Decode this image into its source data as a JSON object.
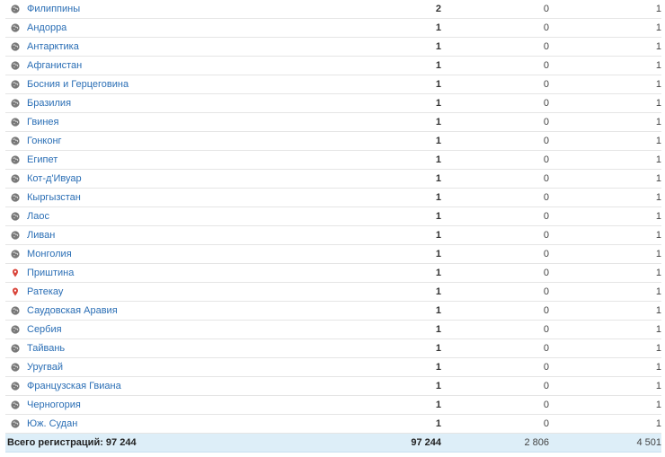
{
  "rows": [
    {
      "name": "Филиппины",
      "icon": "globe-icon",
      "a": "2",
      "b": "0",
      "c": "1"
    },
    {
      "name": "Андорра",
      "icon": "globe-icon",
      "a": "1",
      "b": "0",
      "c": "1"
    },
    {
      "name": "Антарктика",
      "icon": "globe-icon",
      "a": "1",
      "b": "0",
      "c": "1"
    },
    {
      "name": "Афганистан",
      "icon": "globe-icon",
      "a": "1",
      "b": "0",
      "c": "1"
    },
    {
      "name": "Босния и Герцеговина",
      "icon": "globe-icon",
      "a": "1",
      "b": "0",
      "c": "1"
    },
    {
      "name": "Бразилия",
      "icon": "globe-icon",
      "a": "1",
      "b": "0",
      "c": "1"
    },
    {
      "name": "Гвинея",
      "icon": "globe-icon",
      "a": "1",
      "b": "0",
      "c": "1"
    },
    {
      "name": "Гонконг",
      "icon": "globe-icon",
      "a": "1",
      "b": "0",
      "c": "1"
    },
    {
      "name": "Египет",
      "icon": "globe-icon",
      "a": "1",
      "b": "0",
      "c": "1"
    },
    {
      "name": "Кот-д'Ивуар",
      "icon": "globe-icon",
      "a": "1",
      "b": "0",
      "c": "1"
    },
    {
      "name": "Кыргызстан",
      "icon": "globe-icon",
      "a": "1",
      "b": "0",
      "c": "1"
    },
    {
      "name": "Лаос",
      "icon": "globe-icon",
      "a": "1",
      "b": "0",
      "c": "1"
    },
    {
      "name": "Ливан",
      "icon": "globe-icon",
      "a": "1",
      "b": "0",
      "c": "1"
    },
    {
      "name": "Монголия",
      "icon": "globe-icon",
      "a": "1",
      "b": "0",
      "c": "1"
    },
    {
      "name": "Приштина",
      "icon": "map-pin-icon",
      "a": "1",
      "b": "0",
      "c": "1"
    },
    {
      "name": "Ратекау",
      "icon": "map-pin-icon",
      "a": "1",
      "b": "0",
      "c": "1"
    },
    {
      "name": "Саудовская Аравия",
      "icon": "globe-icon",
      "a": "1",
      "b": "0",
      "c": "1"
    },
    {
      "name": "Сербия",
      "icon": "globe-icon",
      "a": "1",
      "b": "0",
      "c": "1"
    },
    {
      "name": "Тайвань",
      "icon": "globe-icon",
      "a": "1",
      "b": "0",
      "c": "1"
    },
    {
      "name": "Уругвай",
      "icon": "globe-icon",
      "a": "1",
      "b": "0",
      "c": "1"
    },
    {
      "name": "Французская Гвиана",
      "icon": "globe-icon",
      "a": "1",
      "b": "0",
      "c": "1"
    },
    {
      "name": "Черногория",
      "icon": "globe-icon",
      "a": "1",
      "b": "0",
      "c": "1"
    },
    {
      "name": "Юж. Судан",
      "icon": "globe-icon",
      "a": "1",
      "b": "0",
      "c": "1"
    }
  ],
  "total": {
    "label": "Всего регистраций: 97 244",
    "a": "97 244",
    "b": "2 806",
    "c": "4 501"
  },
  "colors": {
    "link": "#2a6eb5",
    "total_bg": "#ddeef8",
    "globe": "#777777",
    "pin": "#d9443a"
  }
}
